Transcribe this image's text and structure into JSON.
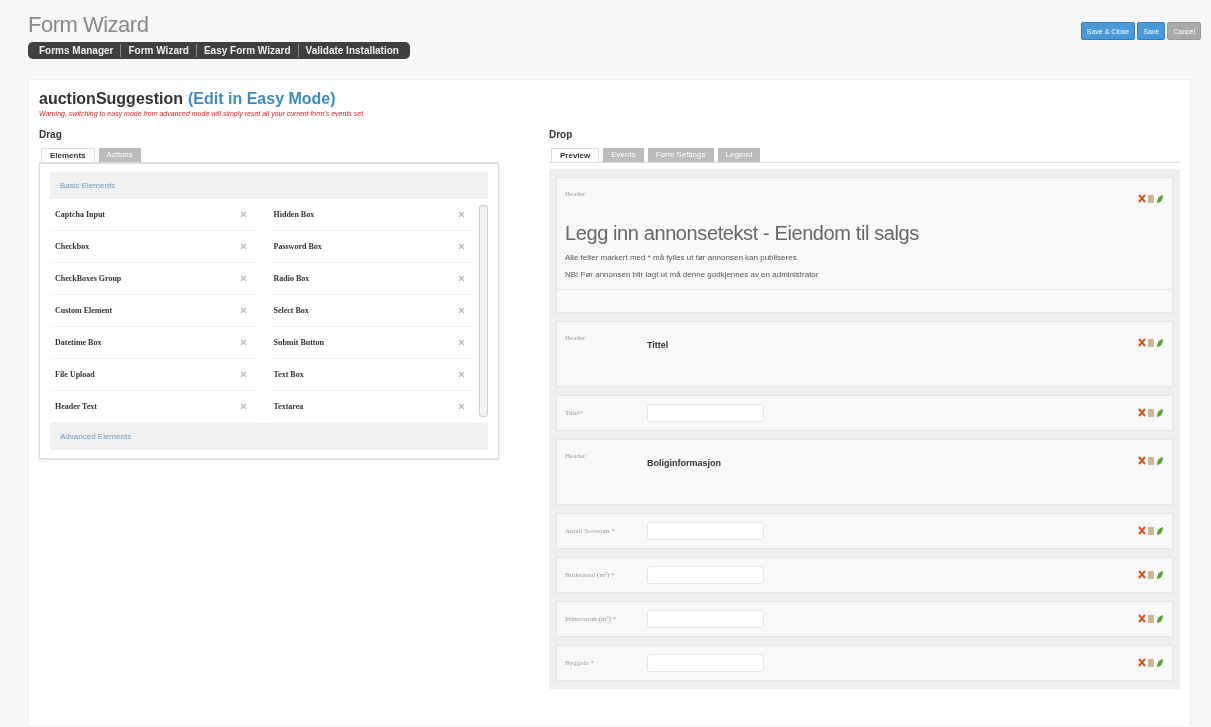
{
  "page_title": "Form Wizard",
  "nav": [
    {
      "label": "Forms Manager"
    },
    {
      "label": "Form Wizard"
    },
    {
      "label": "Easy Form Wizard"
    },
    {
      "label": "Validate Installation"
    }
  ],
  "toolbar": [
    {
      "label": "Save & Close",
      "kind": "primary"
    },
    {
      "label": "Save",
      "kind": "primary"
    },
    {
      "label": "Cancel",
      "kind": "secondary"
    }
  ],
  "form": {
    "name": "auctionSuggestion",
    "mode_link": "(Edit in Easy Mode)",
    "warning": "Warning, switching to easy mode from advanced mode will simply reset all your current form's events set."
  },
  "drag": {
    "title": "Drag",
    "tabs": [
      {
        "label": "Elements",
        "selected": true
      },
      {
        "label": "Actions",
        "selected": false
      }
    ],
    "groups": [
      {
        "title": "Basic Elements",
        "expanded": true,
        "items": [
          "Captcha Input",
          "Hidden Box",
          "Checkbox",
          "Password Box",
          "CheckBoxes Group",
          "Radio Box",
          "Custom Element",
          "Select Box",
          "Datetime Box",
          "Submit Button",
          "File Upload",
          "Text Box",
          "Header Text",
          "Textarea"
        ]
      },
      {
        "title": "Advanced Elements",
        "expanded": false
      }
    ]
  },
  "drop": {
    "title": "Drop",
    "tabs": [
      {
        "label": "Preview",
        "selected": true
      },
      {
        "label": "Events",
        "selected": false
      },
      {
        "label": "Form Settings",
        "selected": false
      },
      {
        "label": "Legend",
        "selected": false
      }
    ],
    "items": [
      {
        "kind": "intro",
        "label": "Header",
        "title": "Legg inn annonsetekst - Eiendom til salgs",
        "lines": [
          "Alle felter markert med * må fylles ut før annonsen kan publiseres",
          "NB! Før annonsen blir lagt ut må denne godkjennes av en administrator"
        ]
      },
      {
        "kind": "header",
        "label": "Header",
        "text": "Tittel"
      },
      {
        "kind": "field",
        "label": "Tittel*"
      },
      {
        "kind": "header",
        "label": "Header",
        "text": "Boliginformasjon"
      },
      {
        "kind": "field",
        "label": "Antall Soverom *"
      },
      {
        "kind": "field",
        "label": "Bruksareal (m²) *"
      },
      {
        "kind": "field",
        "label": "Primærrom (m²) *"
      },
      {
        "kind": "field",
        "label": "Byggeår *"
      }
    ]
  }
}
